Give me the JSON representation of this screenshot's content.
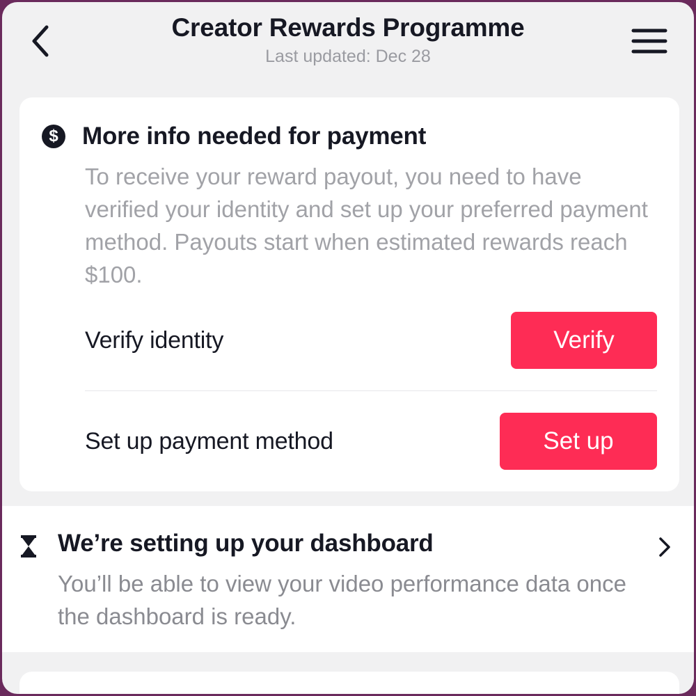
{
  "header": {
    "title": "Creator Rewards Programme",
    "subtitle": "Last updated: Dec 28",
    "back_icon": "chevron-left-icon",
    "menu_icon": "hamburger-menu-icon"
  },
  "payment_card": {
    "icon": "dollar-circle-icon",
    "heading": "More info needed for payment",
    "description": "To receive your reward payout, you need to have verified your identity and set up your preferred payment method. Payouts start when estimated rewards reach $100.",
    "actions": [
      {
        "label": "Verify identity",
        "button": "Verify"
      },
      {
        "label": "Set up payment method",
        "button": "Set up"
      }
    ],
    "button_color": "#fe2c55"
  },
  "dashboard": {
    "icon": "hourglass-icon",
    "title": "We’re setting up your dashboard",
    "description": "You’ll be able to view your video performance data once the dashboard is ready.",
    "chevron_icon": "chevron-right-icon"
  }
}
